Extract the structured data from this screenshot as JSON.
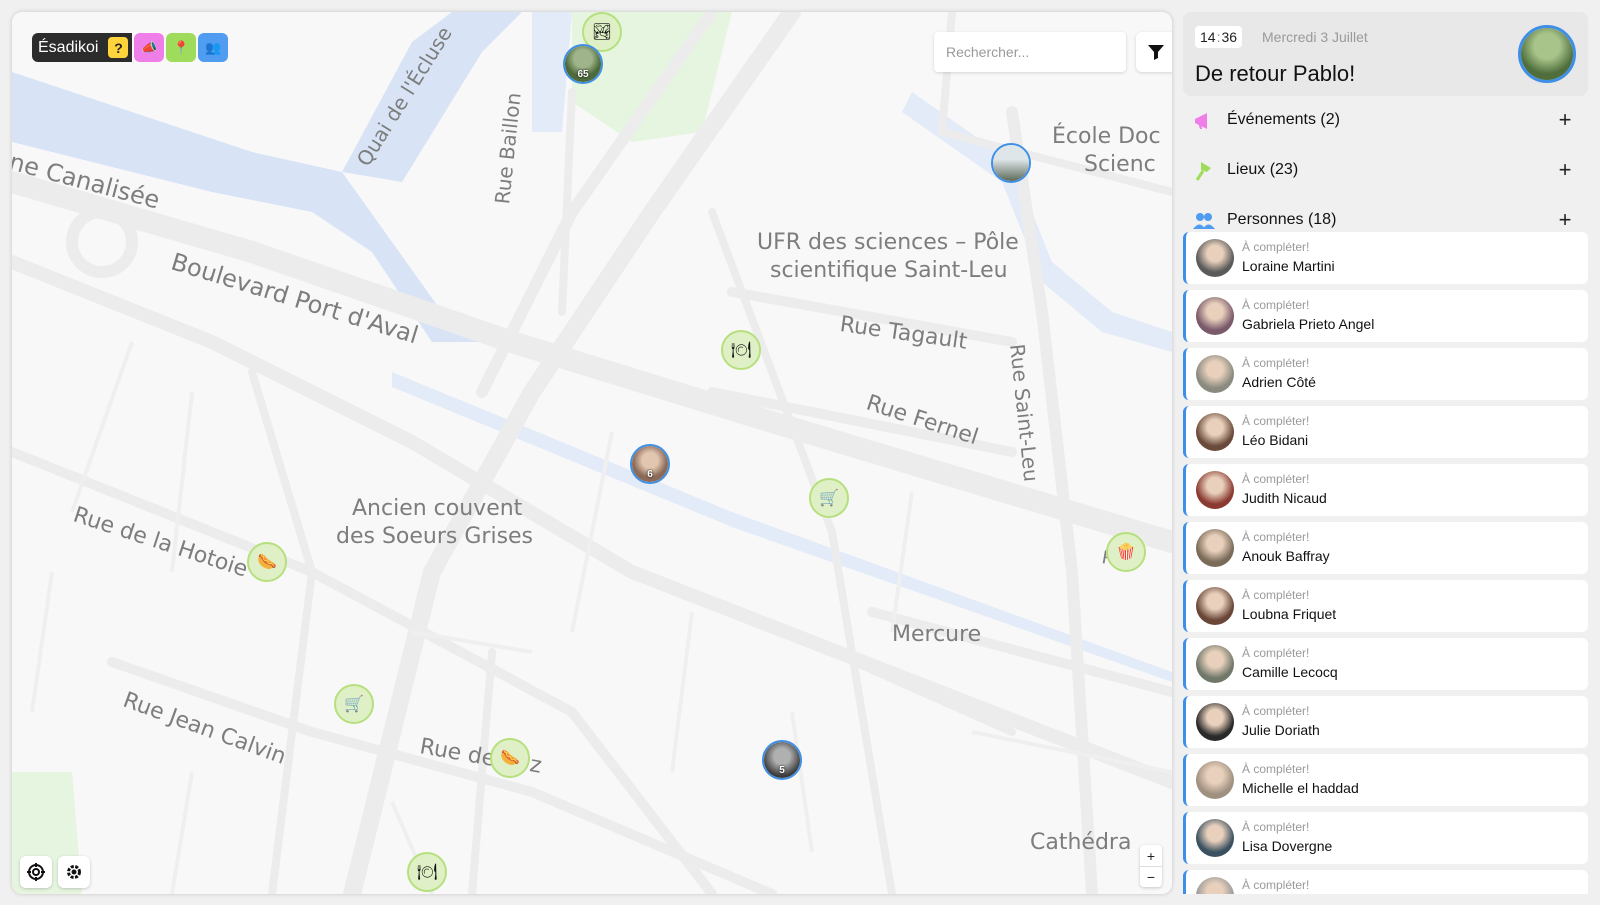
{
  "app": {
    "name": "Ésadikoi",
    "help": "?"
  },
  "filters": [
    {
      "name": "events-filter",
      "icon": "megaphone-icon",
      "color": "#f07ee8",
      "glyph": "📣"
    },
    {
      "name": "places-filter",
      "icon": "pin-icon",
      "color": "#9fdc5c",
      "glyph": "📍"
    },
    {
      "name": "people-filter",
      "icon": "people-icon",
      "color": "#4f9cf1",
      "glyph": "👥"
    }
  ],
  "search": {
    "placeholder": "Rechercher..."
  },
  "map": {
    "labels": [
      {
        "name": "label-canal",
        "text": "ne Canalisée"
      },
      {
        "name": "label-quai",
        "text": "Quai de l'Écluse"
      },
      {
        "name": "label-baillon",
        "text": "Rue Baillon"
      },
      {
        "name": "label-boulevard",
        "text": "Boulevard Port d'Aval"
      },
      {
        "name": "label-ecole",
        "text": "École Doc"
      },
      {
        "name": "label-ecole2",
        "text": "Scienc"
      },
      {
        "name": "label-ufr",
        "text": "UFR des sciences – Pôle"
      },
      {
        "name": "label-ufr2",
        "text": "scientifique Saint-Leu"
      },
      {
        "name": "label-tagault",
        "text": "Rue Tagault"
      },
      {
        "name": "label-fernel",
        "text": "Rue Fernel"
      },
      {
        "name": "label-saintleu",
        "text": "Rue Saint-Leu"
      },
      {
        "name": "label-hotoie",
        "text": "Rue de la Hotoie"
      },
      {
        "name": "label-couvent",
        "text": "Ancien couvent"
      },
      {
        "name": "label-couvent2",
        "text": "des Soeurs Grises"
      },
      {
        "name": "label-mercure",
        "text": "Mercure"
      },
      {
        "name": "label-calvin",
        "text": "Rue Jean Calvin"
      },
      {
        "name": "label-ruede",
        "text": "Rue de"
      },
      {
        "name": "label-z",
        "text": "z"
      },
      {
        "name": "label-cathedrale",
        "text": "Cathédra"
      },
      {
        "name": "label-rue-edge",
        "text": "Rue"
      }
    ],
    "counts": {
      "c1": "65",
      "c2": "6",
      "c3": "5"
    },
    "place_glyphs": {
      "image": "🏞",
      "plate": "🍽",
      "cart": "🛒",
      "hotdog": "🌭",
      "popcorn": "🍿"
    }
  },
  "zoom": {
    "in": "+",
    "out": "−"
  },
  "header": {
    "hour": "14",
    "minute": "36",
    "date": "Mercredi 3 Juillet",
    "welcome": "De retour Pablo!"
  },
  "sections": [
    {
      "label": "Événements (2)",
      "color": "#f07ee8"
    },
    {
      "label": "Lieux (23)",
      "color": "#9fdc5c"
    },
    {
      "label": "Personnes (18)",
      "color": "#4f9cf1"
    }
  ],
  "people": [
    {
      "status": "À compléter!",
      "name": "Loraine Martini",
      "tone": "#5a5a5a"
    },
    {
      "status": "À compléter!",
      "name": "Gabriela Prieto Angel",
      "tone": "#7a5a6a"
    },
    {
      "status": "À compléter!",
      "name": "Adrien Côté",
      "tone": "#8a8a80"
    },
    {
      "status": "À compléter!",
      "name": "Léo Bidani",
      "tone": "#6a4a3a"
    },
    {
      "status": "À compléter!",
      "name": "Judith Nicaud",
      "tone": "#8a3a30"
    },
    {
      "status": "À compléter!",
      "name": "Anouk Baffray",
      "tone": "#7a6a58"
    },
    {
      "status": "À compléter!",
      "name": "Loubna Friquet",
      "tone": "#6a4638"
    },
    {
      "status": "À compléter!",
      "name": "Camille Lecocq",
      "tone": "#70786a"
    },
    {
      "status": "À compléter!",
      "name": "Julie Doriath",
      "tone": "#2a2a2a"
    },
    {
      "status": "À compléter!",
      "name": "Michelle el haddad",
      "tone": "#a09080"
    },
    {
      "status": "À compléter!",
      "name": "Lisa Dovergne",
      "tone": "#3a5060"
    },
    {
      "status": "À compléter!",
      "name": "",
      "tone": "#999999"
    }
  ]
}
